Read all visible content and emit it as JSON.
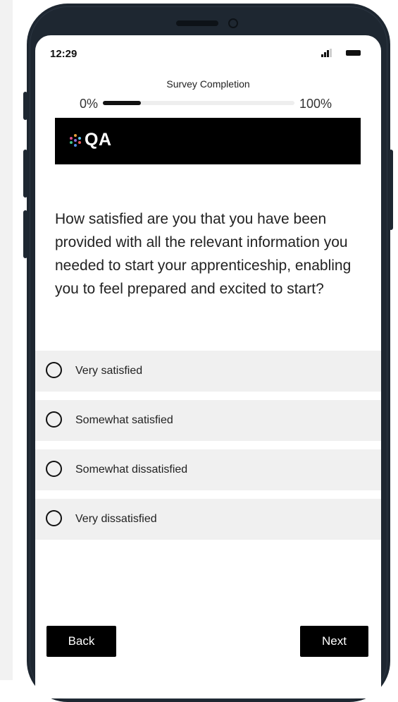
{
  "status_bar": {
    "time": "12:29"
  },
  "progress": {
    "title": "Survey Completion",
    "start_label": "0%",
    "end_label": "100%",
    "value": 0.2
  },
  "banner": {
    "logo_text": "QA",
    "background_color": "#000000"
  },
  "question": {
    "text": "How satisfied are you that you have been provided with all the relevant information you needed to start your apprenticeship, enabling you to feel prepared and excited to start?"
  },
  "options": [
    {
      "label": "Very satisfied"
    },
    {
      "label": "Somewhat satisfied"
    },
    {
      "label": "Somewhat dissatisfied"
    },
    {
      "label": "Very dissatisfied"
    }
  ],
  "navigation": {
    "back_label": "Back",
    "next_label": "Next"
  },
  "colors": {
    "phone_frame": "#1e2731",
    "option_bg": "#f0f0f0",
    "button_bg": "#000000"
  }
}
